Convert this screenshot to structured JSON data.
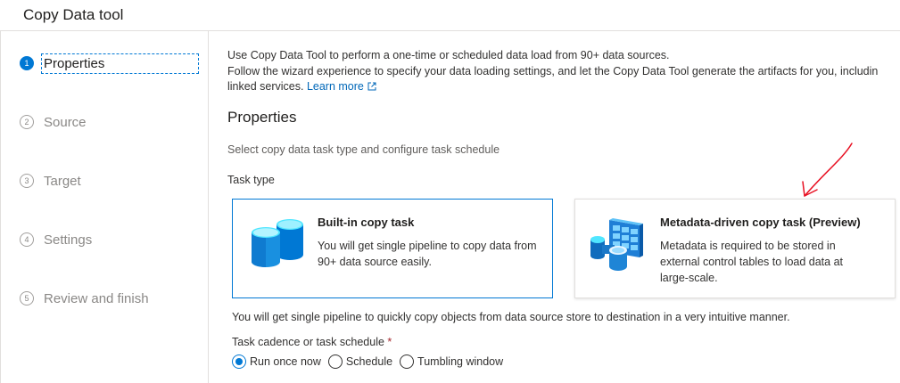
{
  "window": {
    "title": "Copy Data tool"
  },
  "steps": [
    {
      "number": "1",
      "label": "Properties",
      "active": true
    },
    {
      "number": "2",
      "label": "Source"
    },
    {
      "number": "3",
      "label": "Target"
    },
    {
      "number": "4",
      "label": "Settings"
    },
    {
      "number": "5",
      "label": "Review and finish"
    }
  ],
  "intro": {
    "line1": "Use Copy Data Tool to perform a one-time or scheduled data load from 90+ data sources.",
    "line2": "Follow the wizard experience to specify your data loading settings, and let the Copy Data Tool generate the artifacts for you, includin",
    "line3_prefix": "linked services.",
    "learn_more": "Learn more"
  },
  "section": {
    "title": "Properties",
    "subtitle": "Select copy data task type and configure task schedule",
    "task_type_label": "Task type"
  },
  "cards": [
    {
      "title": "Built-in copy task",
      "description": "You will get single pipeline to copy data from 90+ data source easily.",
      "icon": "database-icon",
      "selected": true
    },
    {
      "title": "Metadata-driven copy task (Preview)",
      "description": "Metadata is required to be stored in external control tables to load data at large-scale.",
      "icon": "metadata-table-icon",
      "selected": false
    }
  ],
  "note": "You will get single pipeline to quickly copy objects from data source store to destination in a very intuitive manner.",
  "schedule": {
    "label": "Task cadence or task schedule",
    "required_mark": "*",
    "options": [
      {
        "label": "Run once now",
        "checked": true
      },
      {
        "label": "Schedule",
        "checked": false
      },
      {
        "label": "Tumbling window",
        "checked": false
      }
    ]
  },
  "colors": {
    "accent": "#0078d4",
    "annotation": "#e81123",
    "link": "#0067b8"
  }
}
